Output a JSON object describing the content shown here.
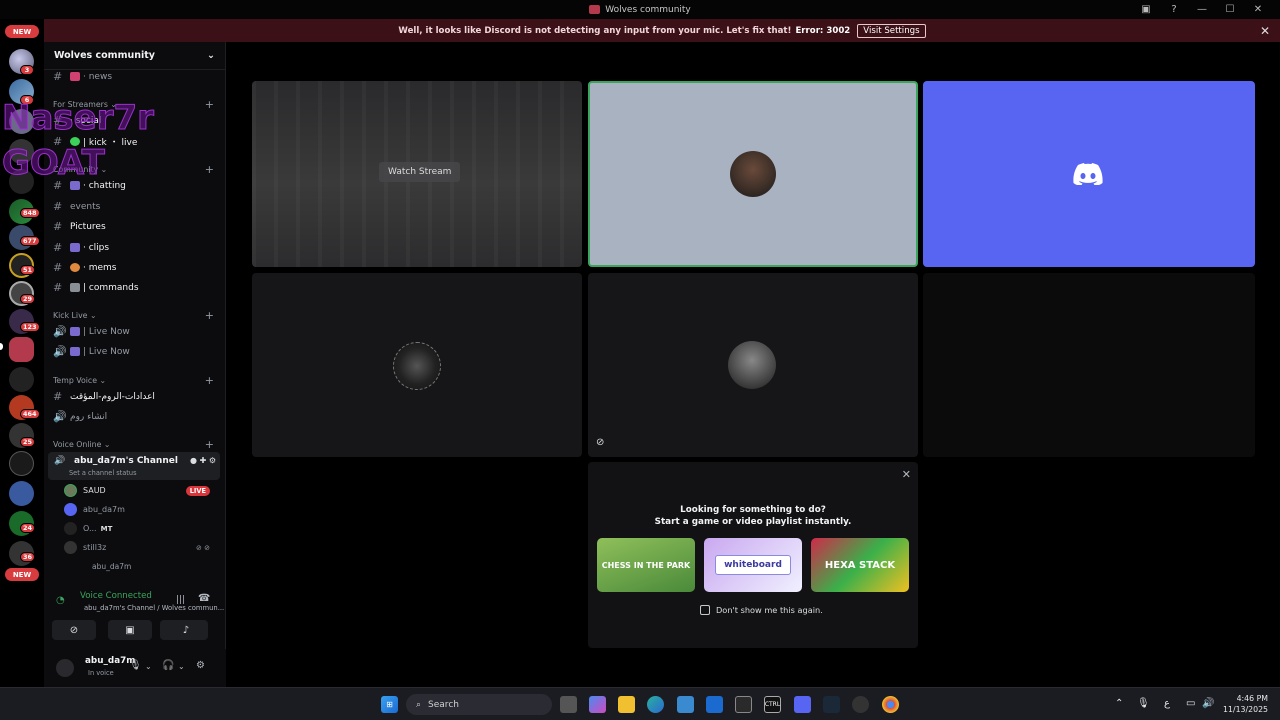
{
  "window": {
    "title": "Wolves community"
  },
  "notice": {
    "message": "Well, it looks like Discord is not detecting any input from your mic. Let's fix that!",
    "error": "Error: 3002",
    "button": "Visit Settings"
  },
  "guilds": {
    "new_top": "NEW",
    "new_bottom": "NEW",
    "badges": [
      "3",
      "6",
      "848",
      "677",
      "51",
      "29",
      "123",
      "464",
      "25",
      "24",
      "36"
    ]
  },
  "server": {
    "name": "Wolves community"
  },
  "channels": [
    {
      "name": "· news"
    },
    {
      "category": "For Streamers"
    },
    {
      "name": "· social"
    },
    {
      "name": "| kick ・ live"
    },
    {
      "category": "Community"
    },
    {
      "name": "· chatting"
    },
    {
      "name": "events"
    },
    {
      "name": "Pictures"
    },
    {
      "name": "· clips"
    },
    {
      "name": "· mems"
    },
    {
      "name": "| commands"
    },
    {
      "category": "Kick Live"
    },
    {
      "name": "| Live Now"
    },
    {
      "name": "| Live Now"
    },
    {
      "category": "Temp Voice"
    },
    {
      "name": "اعدادات-الروم-المؤقت"
    },
    {
      "name": "انشاء روم"
    },
    {
      "category": "Voice Online"
    }
  ],
  "voice_channel": {
    "name": "abu_da7m's Channel",
    "status": "Set a channel status"
  },
  "voice_users": [
    {
      "name": "SAUD",
      "badge": "LIVE"
    },
    {
      "name": "abu_da7m"
    },
    {
      "name": "O...",
      "tag": "MT"
    },
    {
      "name": "still3z"
    },
    {
      "name": "abu_da7m"
    }
  ],
  "overlay_text": [
    "Naser7r",
    "GOAT"
  ],
  "voice_panel": {
    "status": "Voice Connected",
    "location": "abu_da7m's Channel / Wolves commun..."
  },
  "user": {
    "name": "abu_da7m",
    "status": "In voice"
  },
  "stage": {
    "watch_button": "Watch Stream"
  },
  "popup": {
    "title1": "Looking for something to do?",
    "title2": "Start a game or video playlist instantly.",
    "activities": [
      "CHESS IN THE PARK",
      "whiteboard",
      "HEXA STACK"
    ],
    "checkbox": "Don't show me this again."
  },
  "taskbar": {
    "search": "Search",
    "time": "4:46 PM",
    "date": "11/13/2025",
    "lang": "ع"
  },
  "colors": {
    "accent": "#5865f2",
    "notice_bg": "#3b1016",
    "live": "#da373c",
    "connected": "#3ba55d"
  }
}
